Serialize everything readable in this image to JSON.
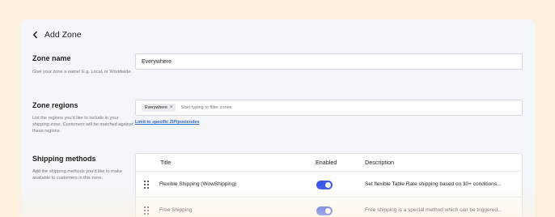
{
  "header": {
    "title": "Add Zone"
  },
  "zone_name": {
    "title": "Zone name",
    "description": "Give your zone a name! E.g. Local, or Worldwide.",
    "value": "Everywhere"
  },
  "zone_regions": {
    "title": "Zone regions",
    "description": "List the regions you'd like to include in your shipping zone. Customers will be matched against these regions.",
    "chip": "Everywhere",
    "chip_remove": "×",
    "placeholder": "Start typing to filter zones",
    "link": "Limit to specific ZIP/postcodes"
  },
  "shipping_methods": {
    "title": "Shipping methods",
    "description": "Add the shipping methods you'd like to make available to customers in this zone.",
    "columns": {
      "title": "Title",
      "enabled": "Enabled",
      "description": "Description"
    },
    "rows": [
      {
        "title": "Flexible Shipping (WowShipping)",
        "enabled": true,
        "description": "Set flexible Table Rate shipping based on 30+ conditions..."
      },
      {
        "title": "Free Shipping",
        "enabled": true,
        "description": "Free shipping is a special method which can be triggered..."
      }
    ]
  },
  "colors": {
    "accent": "#3858e9",
    "link": "#2a66c8",
    "background": "#fdf0dc",
    "panel": "#f4f6fb"
  }
}
